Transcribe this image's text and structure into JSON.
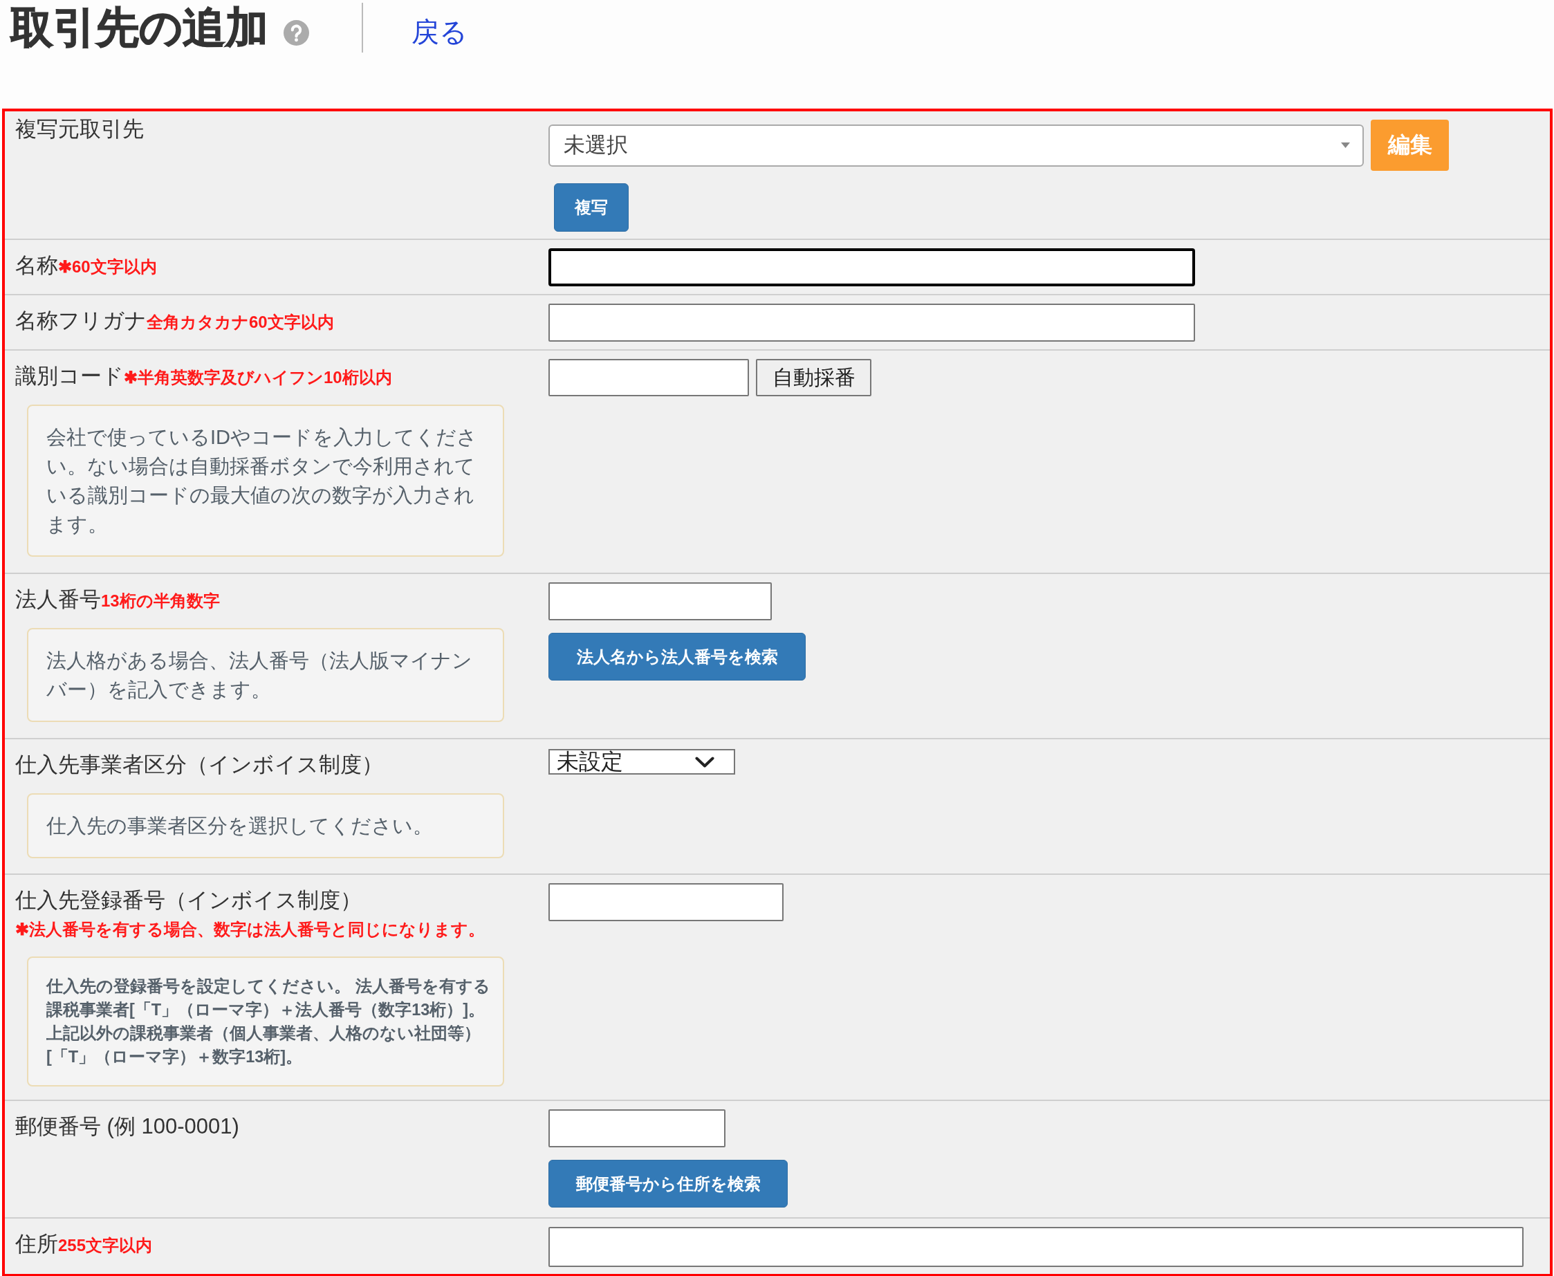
{
  "header": {
    "title": "取引先の追加",
    "back_link": "戻る"
  },
  "form": {
    "rows": [
      {
        "label": "複写元取引先",
        "lines": [
          [
            {
              "kind": "combobox",
              "value": "未選択"
            },
            {
              "kind": "button",
              "label": "編集"
            }
          ],
          [
            {
              "kind": "button",
              "label": "複写"
            }
          ]
        ]
      },
      {
        "label": "名称",
        "note": "✱60文字以内",
        "lines": [
          [
            {
              "kind": "text",
              "focused": true
            }
          ]
        ]
      },
      {
        "label": "名称フリガナ",
        "note": "全角カタカナ60文字以内",
        "lines": [
          [
            {
              "kind": "text",
              "focused": false
            }
          ]
        ]
      },
      {
        "label": "識別コード",
        "note": "✱半角英数字及びハイフン10桁以内",
        "help": "会社で使っているIDやコードを入力してください。ない場合は自動採番ボタンで今利用されている識別コードの最大値の次の数字が入力されます。",
        "lines": [
          [
            {
              "kind": "text",
              "focused": false
            },
            {
              "kind": "button",
              "label": "自動採番"
            }
          ]
        ]
      },
      {
        "label": "法人番号",
        "note": "13桁の半角数字",
        "help": "法人格がある場合、法人番号（法人版マイナンバー）を記入できます。",
        "lines": [
          [
            {
              "kind": "text",
              "focused": false
            }
          ],
          [
            {
              "kind": "button",
              "label": "法人名から法人番号を検索"
            }
          ]
        ]
      },
      {
        "label": "仕入先事業者区分（インボイス制度）",
        "help": "仕入先の事業者区分を選択してください。",
        "lines": [
          [
            {
              "kind": "select",
              "value": "未設定"
            }
          ]
        ]
      },
      {
        "label": "仕入先登録番号（インボイス制度）",
        "note": "✱法人番号を有する場合、数字は法人番号と同じになります。",
        "help": "仕入先の登録番号を設定してください。 法人番号を有する課税事業者[「T」（ローマ字）＋法人番号（数字13桁）]。上記以外の課税事業者（個人事業者、人格のない社団等）[「T」（ローマ字）＋数字13桁]。",
        "lines": [
          [
            {
              "kind": "text",
              "focused": false
            }
          ]
        ]
      },
      {
        "label": "郵便番号 (例 100-0001)",
        "lines": [
          [
            {
              "kind": "text",
              "focused": false
            }
          ],
          [
            {
              "kind": "button",
              "label": "郵便番号から住所を検索"
            }
          ]
        ]
      },
      {
        "label": "住所",
        "note": "255文字以内",
        "lines": [
          [
            {
              "kind": "text",
              "focused": false
            }
          ]
        ]
      }
    ]
  }
}
